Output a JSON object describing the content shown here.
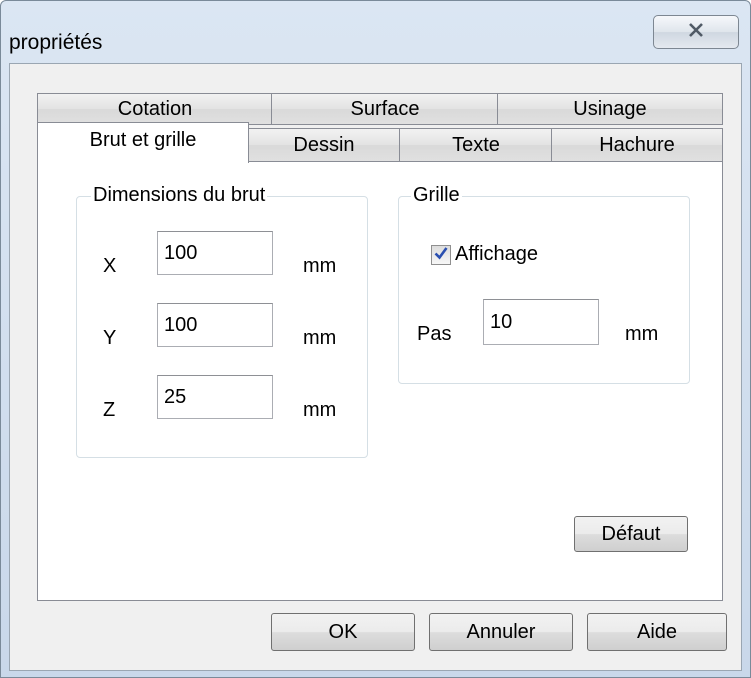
{
  "window": {
    "title": "propriétés",
    "close_icon": "close-x-icon"
  },
  "tabs": {
    "row_back": [
      "Cotation",
      "Surface",
      "Usinage"
    ],
    "row_front": [
      "Brut et grille",
      "Dessin",
      "Texte",
      "Hachure"
    ],
    "active": "Brut et grille"
  },
  "brut": {
    "legend": "Dimensions du brut",
    "x_label": "X",
    "x_value": "100",
    "y_label": "Y",
    "y_value": "100",
    "z_label": "Z",
    "z_value": "25",
    "unit": "mm"
  },
  "grille": {
    "legend": "Grille",
    "affichage_label": "Affichage",
    "affichage_checked": true,
    "pas_label": "Pas",
    "pas_value": "10",
    "unit": "mm"
  },
  "buttons": {
    "default": "Défaut",
    "ok": "OK",
    "cancel": "Annuler",
    "help": "Aide"
  }
}
